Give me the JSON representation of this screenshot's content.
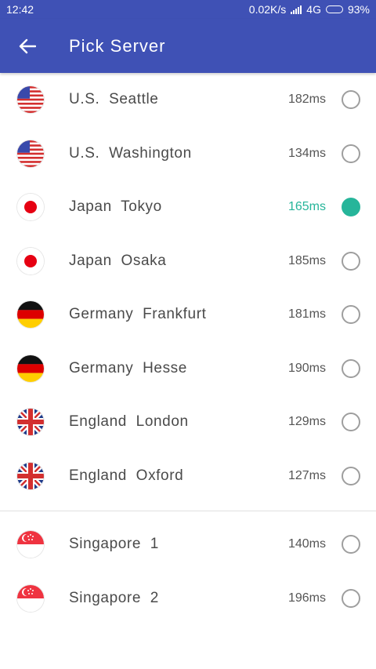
{
  "status_bar": {
    "time": "12:42",
    "speed": "0.02K/s",
    "network": "4G",
    "battery": "93%",
    "battery_level": 0.93
  },
  "app_bar": {
    "title": "Pick Server"
  },
  "servers_group1": [
    {
      "name": "U.S.  Seattle",
      "ping": "182ms",
      "flag": "us",
      "selected": false
    },
    {
      "name": "U.S.  Washington",
      "ping": "134ms",
      "flag": "us",
      "selected": false
    },
    {
      "name": "Japan  Tokyo",
      "ping": "165ms",
      "flag": "jp",
      "selected": true
    },
    {
      "name": "Japan  Osaka",
      "ping": "185ms",
      "flag": "jp",
      "selected": false
    },
    {
      "name": "Germany  Frankfurt",
      "ping": "181ms",
      "flag": "de",
      "selected": false
    },
    {
      "name": "Germany  Hesse",
      "ping": "190ms",
      "flag": "de",
      "selected": false
    },
    {
      "name": "England  London",
      "ping": "129ms",
      "flag": "gb",
      "selected": false
    },
    {
      "name": "England  Oxford",
      "ping": "127ms",
      "flag": "gb",
      "selected": false
    }
  ],
  "servers_group2": [
    {
      "name": "Singapore  1",
      "ping": "140ms",
      "flag": "sg",
      "selected": false
    },
    {
      "name": "Singapore  2",
      "ping": "196ms",
      "flag": "sg",
      "selected": false
    }
  ],
  "colors": {
    "primary": "#3f51b5",
    "accent": "#26b59a"
  }
}
